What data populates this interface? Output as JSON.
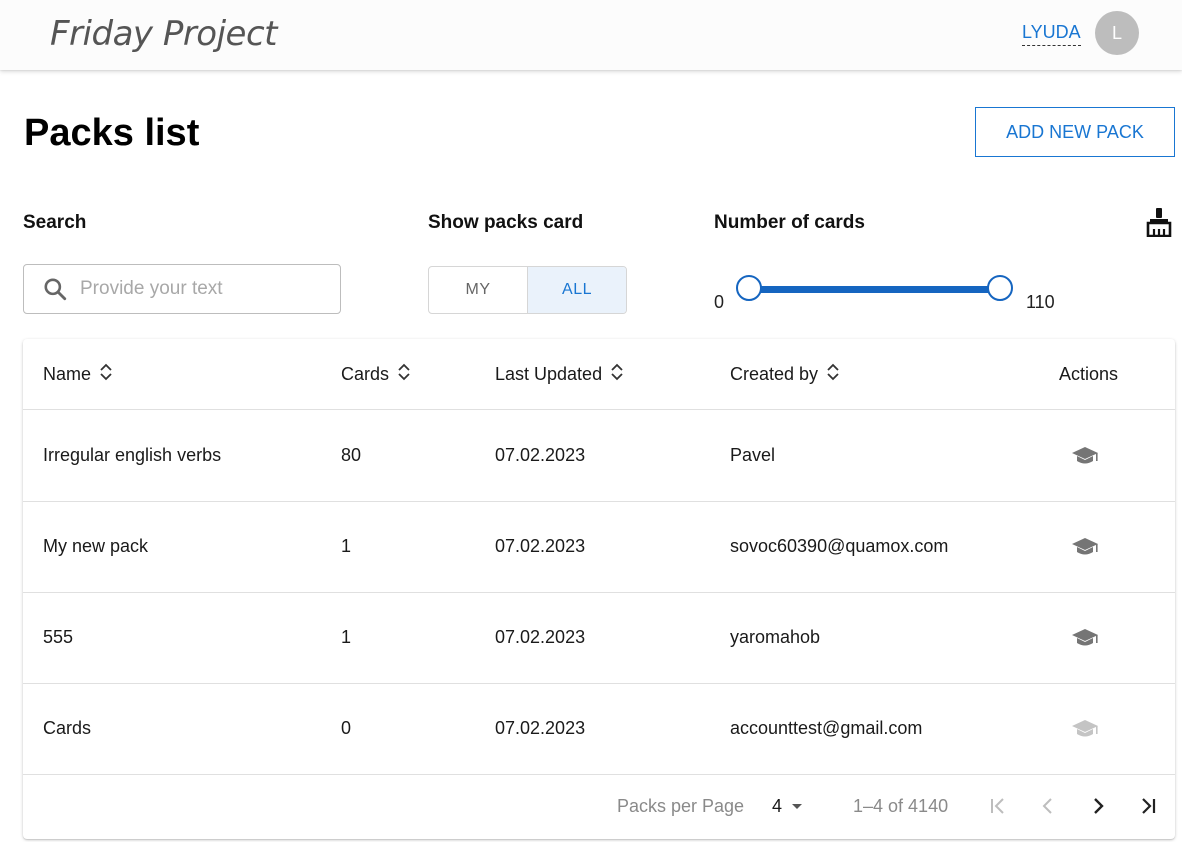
{
  "header": {
    "logo": "Friday Project",
    "user_name": "LYUDA",
    "avatar_letter": "L"
  },
  "page": {
    "title": "Packs list",
    "add_button": "ADD NEW PACK"
  },
  "filters": {
    "search_label": "Search",
    "search_placeholder": "Provide your text",
    "search_value": "",
    "show_label": "Show packs card",
    "toggle": [
      {
        "label": "MY",
        "active": false
      },
      {
        "label": "ALL",
        "active": true
      }
    ],
    "cards_label": "Number of cards",
    "range_min": "0",
    "range_max": "110"
  },
  "table": {
    "headers": [
      "Name",
      "Cards",
      "Last Updated",
      "Created by",
      "Actions"
    ],
    "rows": [
      {
        "name": "Irregular english verbs",
        "cards": "80",
        "updated": "07.02.2023",
        "created_by": "Pavel"
      },
      {
        "name": "My new pack",
        "cards": "1",
        "updated": "07.02.2023",
        "created_by": "sovoc60390@quamox.com"
      },
      {
        "name": "555",
        "cards": "1",
        "updated": "07.02.2023",
        "created_by": "yaromahob"
      },
      {
        "name": "Cards",
        "cards": "0",
        "updated": "07.02.2023",
        "created_by": "accounttest@gmail.com"
      }
    ]
  },
  "pagination": {
    "per_page_label": "Packs per Page",
    "per_page_value": "4",
    "range_text": "1–4 of 4140"
  },
  "colors": {
    "accent": "#1976d2",
    "icon": "#757575",
    "icon_disabled": "#c4c4c4"
  }
}
